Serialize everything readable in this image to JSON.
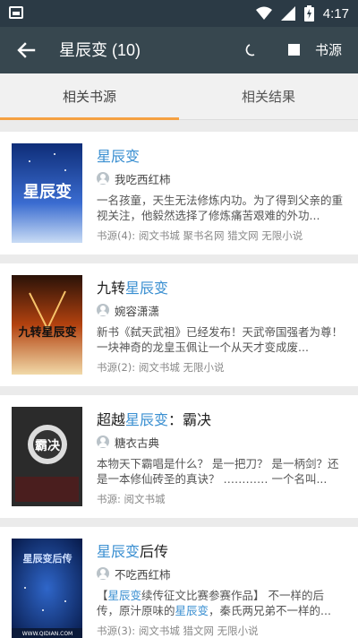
{
  "status_bar": {
    "time": "4:17"
  },
  "toolbar": {
    "title": "星辰变 (10)",
    "source_button": "书源"
  },
  "tabs": [
    {
      "label": "相关书源"
    },
    {
      "label": "相关结果"
    }
  ],
  "books": [
    {
      "title_prefix": "",
      "title_highlight": "星辰变",
      "title_suffix": "",
      "author": "我吃西红柿",
      "intro_parts": [
        "一名孩童，天生无法修炼内功。为了得到父亲的重视关注，他毅然选择了修炼痛苦艰难的外功..."
      ],
      "sources": "书源(4): 阅文书城 聚书名网 猎文网 无限小说",
      "cover_text": "星辰变"
    },
    {
      "title_prefix": "九转",
      "title_highlight": "星辰变",
      "title_suffix": "",
      "author": "婉容潇潇",
      "intro_parts": [
        "新书《弑天武祖》已经发布！天武帝国强者为尊！一块神奇的龙皇玉佩让一个从天才变成废..."
      ],
      "sources": "书源(2): 阅文书城 无限小说",
      "cover_text": "九转星辰变"
    },
    {
      "title_prefix": "超越",
      "title_highlight": "星辰变",
      "title_suffix": "：霸决",
      "author": "糖衣古典",
      "intro_parts": [
        "本物天下霸唱是什么？ 是一把刀？ 是一柄剑？还是一本修仙砖圣的真诀？ ………… 一个名叫..."
      ],
      "sources": "书源: 阅文书城",
      "cover_text": "霸决"
    },
    {
      "title_prefix": "",
      "title_highlight": "星辰变",
      "title_suffix": "后传",
      "author": "不吃西红柿",
      "intro_parts": [
        "【",
        "星辰变",
        "续传征文比赛参赛作品】 不一样的后传，原汁原味的",
        "星辰变",
        "，秦氏两兄弟不一样的..."
      ],
      "sources": "书源(3): 阅文书城 猎文网 无限小说",
      "cover_text": "星辰变后传",
      "cover_url": "WWW.QIDIAN.COM"
    }
  ],
  "colors": {
    "status_bar": "#2b3a45",
    "toolbar": "#37474f",
    "tab_indicator": "#f5a142",
    "highlight": "#3a8fd1"
  }
}
